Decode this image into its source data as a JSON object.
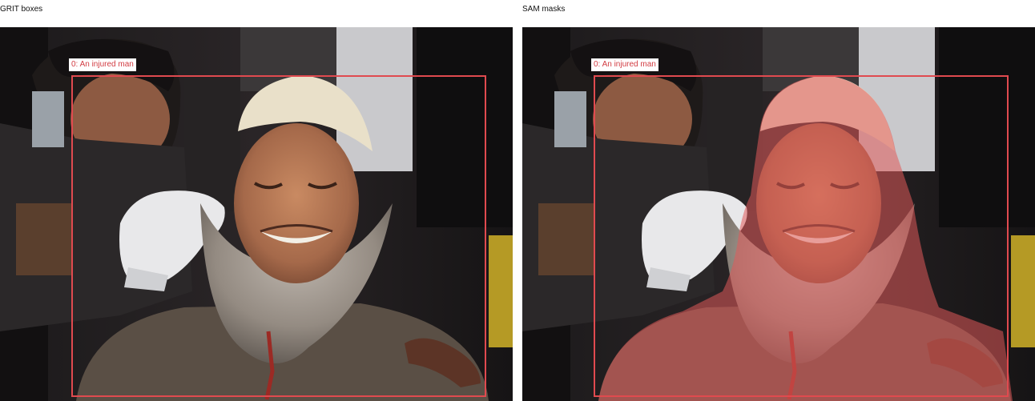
{
  "panels": [
    {
      "title": "GRIT boxes",
      "boxes": [
        {
          "label": "0: An injured man"
        }
      ]
    },
    {
      "title": "SAM masks",
      "boxes": [
        {
          "label": "0: An injured man"
        }
      ]
    }
  ],
  "colors": {
    "box_outline": "#e04a4f",
    "label_text": "#d23c42",
    "mask_fill": "#e05a5a"
  }
}
